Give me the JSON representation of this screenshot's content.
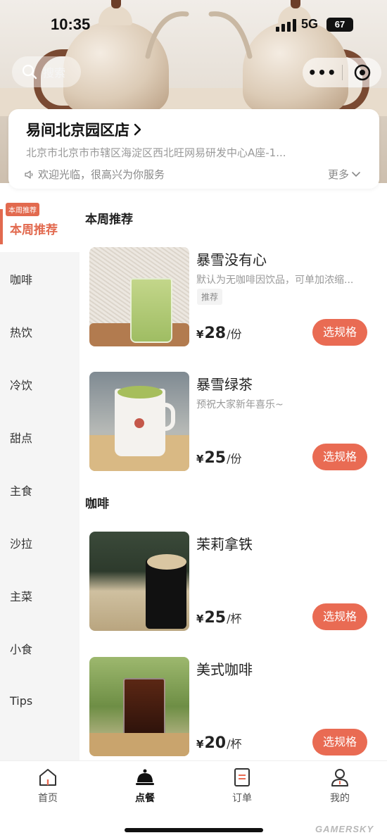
{
  "status_bar": {
    "time": "10:35",
    "network": "5G",
    "battery": "67"
  },
  "header": {
    "search_placeholder": "搜索",
    "more_icon": "more-dots-icon",
    "close_icon": "target-circle-icon"
  },
  "store": {
    "name": "易间北京园区店",
    "address": "北京市北京市市辖区海淀区西北旺网易研发中心A座-1...",
    "notice": "欢迎光临，很高兴为你服务",
    "more_label": "更多"
  },
  "sidebar": {
    "badge": "本周推荐",
    "items": [
      {
        "label": "本周推荐",
        "active": true
      },
      {
        "label": "咖啡"
      },
      {
        "label": "热饮"
      },
      {
        "label": "冷饮"
      },
      {
        "label": "甜点"
      },
      {
        "label": "主食"
      },
      {
        "label": "沙拉"
      },
      {
        "label": "主菜"
      },
      {
        "label": "小食"
      },
      {
        "label": "Tips"
      }
    ]
  },
  "sections": [
    {
      "title": "本周推荐",
      "products": [
        {
          "name": "暴雪没有心",
          "desc": "默认为无咖啡因饮品，可单加浓缩...",
          "tag": "推荐",
          "currency": "¥",
          "price": "28",
          "unit": "/份",
          "button": "选规格"
        },
        {
          "name": "暴雪绿茶",
          "desc": "预祝大家新年喜乐~",
          "currency": "¥",
          "price": "25",
          "unit": "/份",
          "button": "选规格"
        }
      ]
    },
    {
      "title": "咖啡",
      "products": [
        {
          "name": "茉莉拿铁",
          "currency": "¥",
          "price": "25",
          "unit": "/杯",
          "button": "选规格"
        },
        {
          "name": "美式咖啡",
          "currency": "¥",
          "price": "20",
          "unit": "/杯",
          "button": "选规格"
        }
      ]
    }
  ],
  "tabbar": [
    {
      "label": "首页",
      "icon": "home-icon"
    },
    {
      "label": "点餐",
      "icon": "cloche-icon",
      "active": true
    },
    {
      "label": "订单",
      "icon": "order-list-icon"
    },
    {
      "label": "我的",
      "icon": "profile-icon"
    }
  ],
  "watermark": "GAMERSKY",
  "colors": {
    "accent": "#e96b53",
    "sidebar_bg": "#f5f5f5",
    "muted_text": "#999999"
  }
}
